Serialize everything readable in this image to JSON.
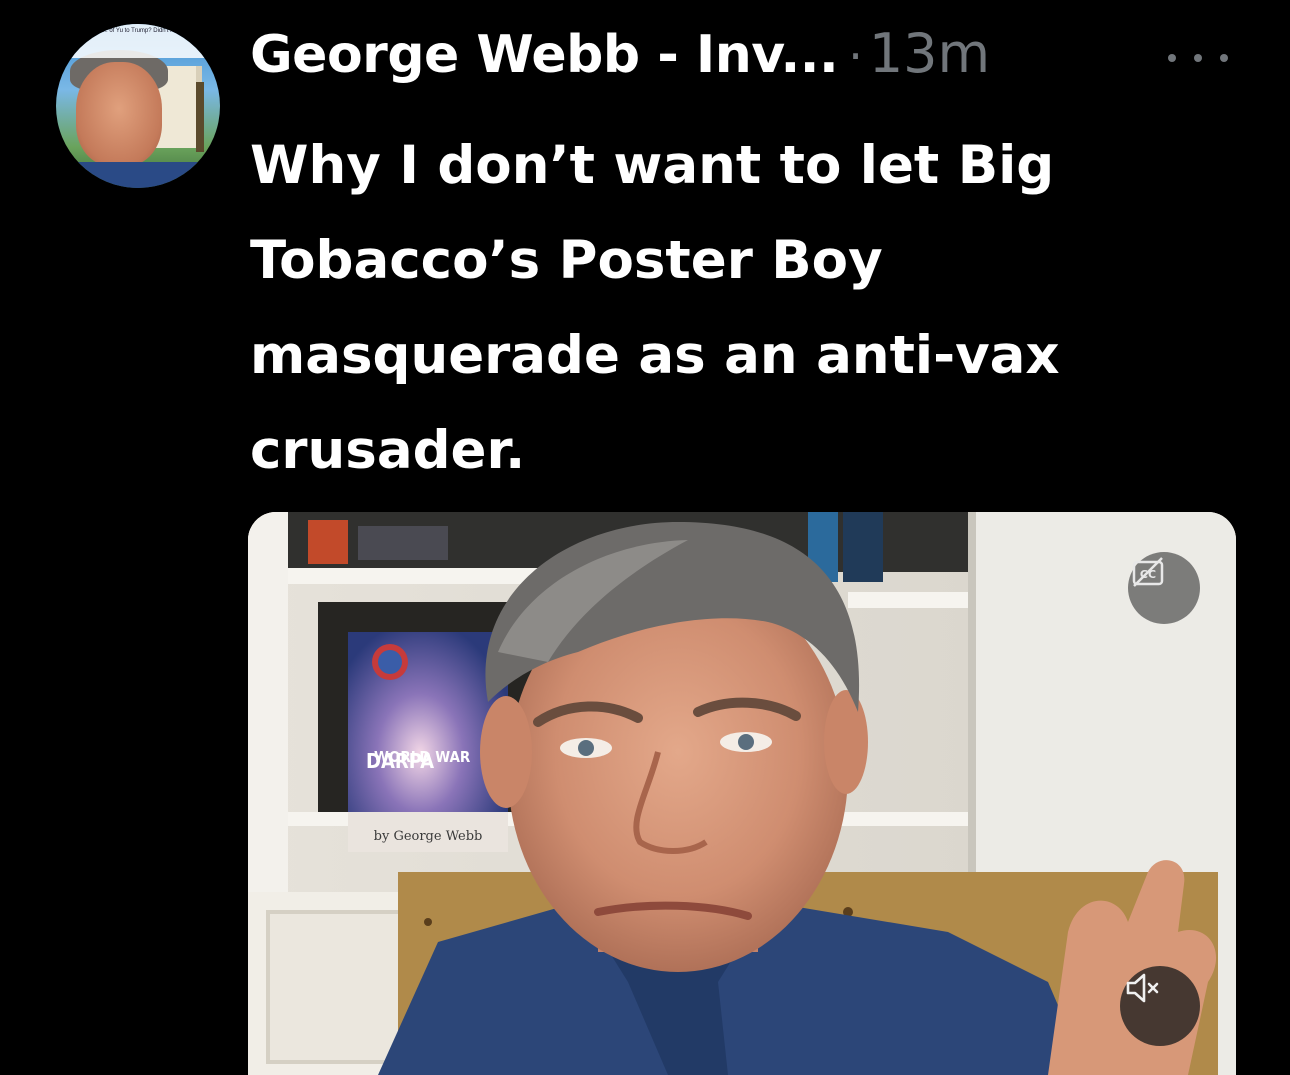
{
  "author": {
    "display_name": "George Webb - Inv...",
    "separator": "·",
    "timestamp": "13m",
    "avatar_caption": "...ative Journalist ... of Yu to Trump? Didn't he... ...ness deals with Hunter Biden with his ..."
  },
  "tweet": {
    "text": "Why I don’t want to let Big Tobacco’s Poster Boy masquerade as an anti-vax crusader."
  },
  "media": {
    "book_top_text": "WORLD WAR",
    "book_title": "DARPA",
    "book_author": "by George Webb"
  },
  "icons": {
    "more": "more-horizontal-icon",
    "captions": "closed-captions-off-icon",
    "mute": "volume-muted-icon"
  },
  "colors": {
    "background": "#000000",
    "text_primary": "#ffffff",
    "text_secondary": "#71767b"
  }
}
